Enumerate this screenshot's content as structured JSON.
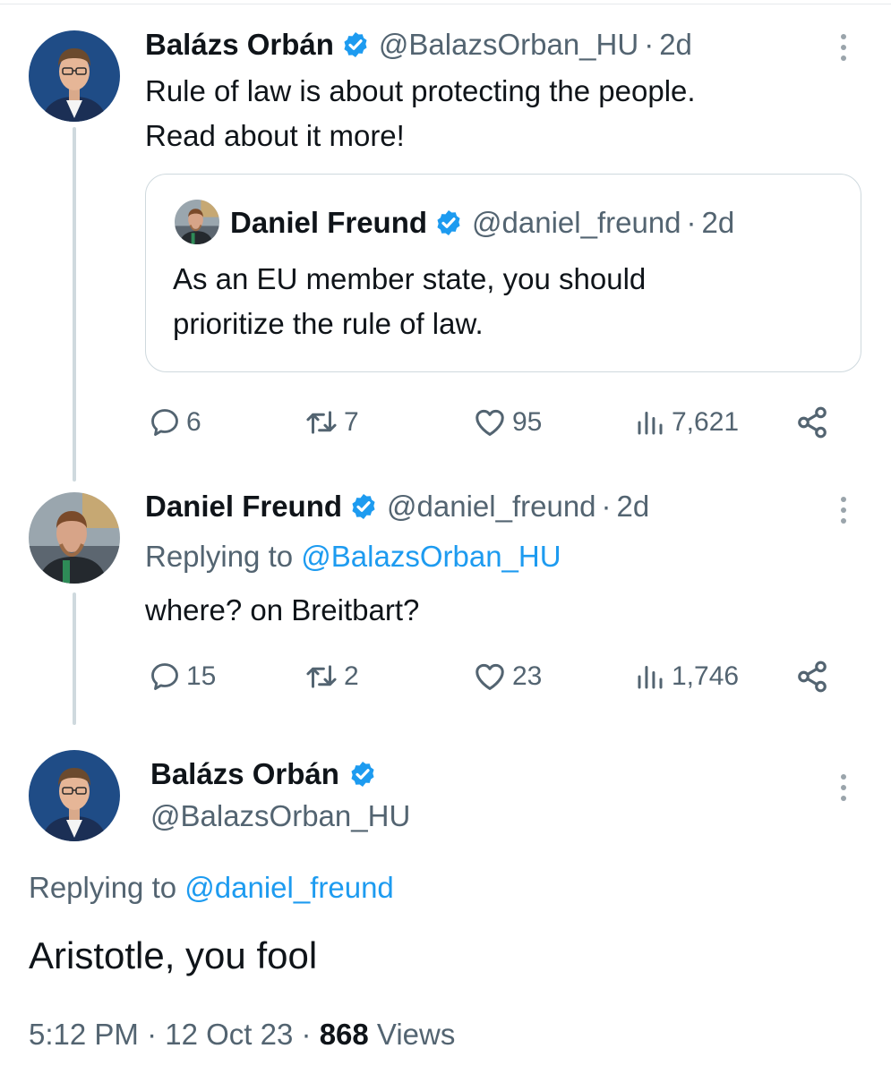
{
  "tweets": [
    {
      "author_name": "Balázs Orbán",
      "handle": "@BalazsOrban_HU",
      "separator": "·",
      "time": "2d",
      "text_lines": [
        "Rule of law is about protecting the people.",
        "Read about it more!"
      ],
      "quote": {
        "author_name": "Daniel Freund",
        "handle": "@daniel_freund",
        "separator": "·",
        "time": "2d",
        "text_lines": [
          "As an EU member state, you should",
          "prioritize the rule of law."
        ]
      },
      "stats": {
        "replies": "6",
        "retweets": "7",
        "likes": "95",
        "views": "7,621"
      }
    },
    {
      "author_name": "Daniel Freund",
      "handle": "@daniel_freund",
      "separator": "·",
      "time": "2d",
      "replying_prefix": "Replying to",
      "replying_to": "@BalazsOrban_HU",
      "text": "where? on Breitbart?",
      "stats": {
        "replies": "15",
        "retweets": "2",
        "likes": "23",
        "views": "1,746"
      }
    }
  ],
  "main_tweet": {
    "author_name": "Balázs Orbán",
    "handle": "@BalazsOrban_HU",
    "replying_prefix": "Replying to",
    "replying_to": "@daniel_freund",
    "text": "Aristotle, you fool",
    "time": "5:12 PM",
    "separator1": "·",
    "date": "12 Oct 23",
    "separator2": "·",
    "views_count": "868",
    "views_label": "Views"
  },
  "colors": {
    "accent": "#1d9bf0",
    "text": "#0f1419",
    "secondary": "#536471",
    "thread_line": "#cfd9de"
  },
  "icons": [
    "verified-badge-icon",
    "more-options-icon",
    "reply-icon",
    "retweet-icon",
    "like-icon",
    "views-icon",
    "share-icon"
  ]
}
